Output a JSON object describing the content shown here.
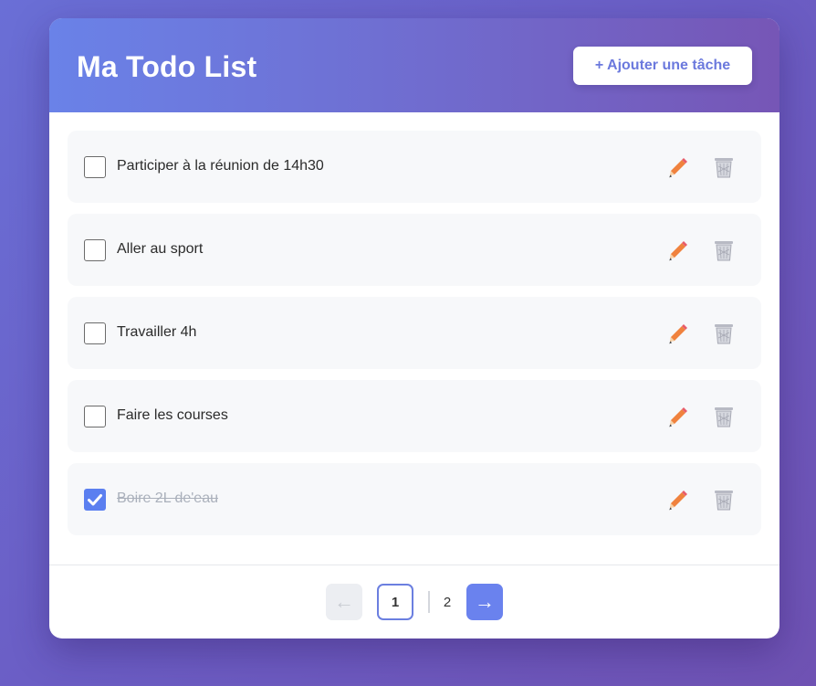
{
  "header": {
    "title": "Ma Todo List",
    "add_button_label": "+ Ajouter une tâche"
  },
  "tasks": [
    {
      "label": "Participer à la réunion de 14h30",
      "done": false
    },
    {
      "label": "Aller au sport",
      "done": false
    },
    {
      "label": "Travailler 4h",
      "done": false
    },
    {
      "label": "Faire les courses",
      "done": false
    },
    {
      "label": "Boire 2L de'eau",
      "done": true
    }
  ],
  "icons": {
    "edit": "pencil-icon",
    "delete": "trash-icon",
    "checked": "checkmark-icon"
  },
  "pagination": {
    "prev_label": "←",
    "pages": [
      "1",
      "2"
    ],
    "current": "1",
    "next_label": "→"
  },
  "colors": {
    "accent": "#6a82ee",
    "checkbox_checked": "#5b7ff0",
    "pencil": "#f07a3a"
  }
}
